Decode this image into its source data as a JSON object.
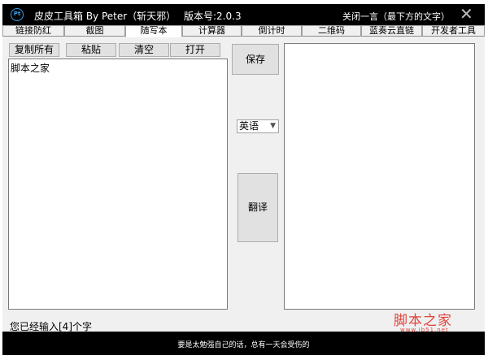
{
  "app": {
    "logo_text": "Pt",
    "title": "皮皮工具箱 By Peter（斩天邪）",
    "version": "版本号:2.0.3",
    "close_hint": "关闭一言（最下方的文字）",
    "close_glyph": "✕"
  },
  "tabs": [
    {
      "label": "链接防红"
    },
    {
      "label": "截图"
    },
    {
      "label": "随写本",
      "active": true
    },
    {
      "label": "计算器"
    },
    {
      "label": "倒计时"
    },
    {
      "label": "二维码"
    },
    {
      "label": "蓝奏云直链"
    },
    {
      "label": "开发者工具"
    }
  ],
  "toolbar": {
    "copy_all": "复制所有",
    "paste": "粘贴",
    "clear": "清空",
    "open": "打开"
  },
  "editor": {
    "text": "脚本之家"
  },
  "side": {
    "save": "保存",
    "language": "英语",
    "translate": "翻译"
  },
  "output": {
    "text": ""
  },
  "status": {
    "char_count": "您已经输入[4]个字"
  },
  "watermark": {
    "main": "脚本之家",
    "sub": "www.jb51.net"
  },
  "footer": {
    "quote": "要是太勉强自己的话，总有一天会受伤的"
  }
}
